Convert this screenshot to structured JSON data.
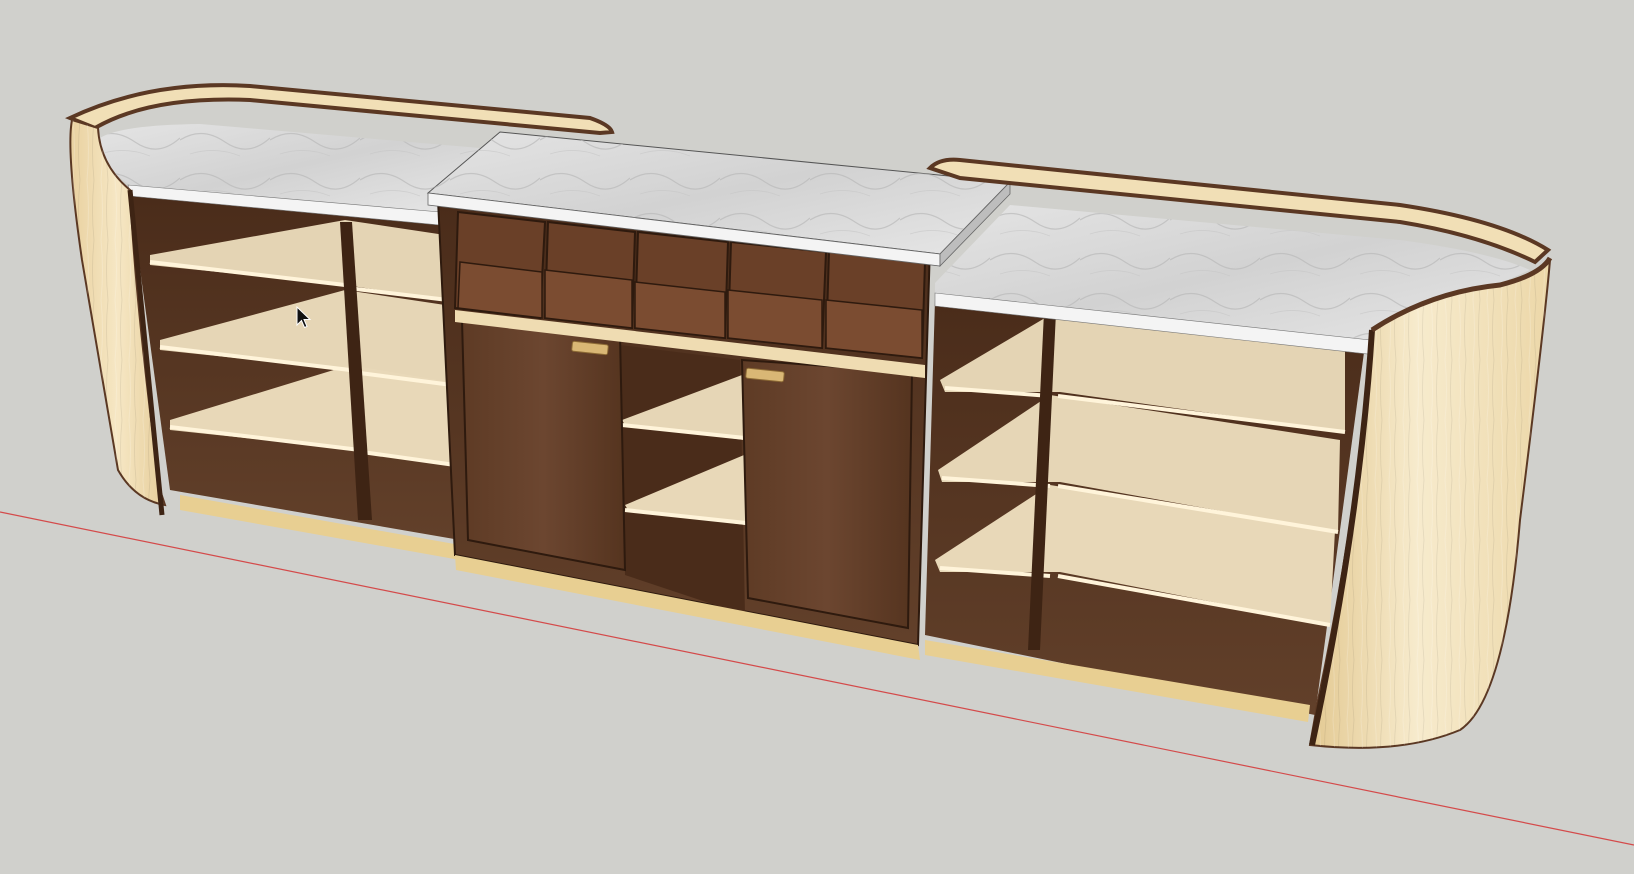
{
  "viewport": {
    "background_color": "#d0d0cc",
    "axis_color": "#d44a4a"
  },
  "model": {
    "materials": {
      "maple_veneer": "#efdcb2",
      "walnut": "#5b3823",
      "walnut_dark": "#3e2414",
      "shelf": "#e6d6b6",
      "marble": "#dcdcdc",
      "plinth": "#e8cf92",
      "brass": "#d9b775"
    },
    "bins_count": 5,
    "doors_count": 2
  },
  "cursor": {
    "icon": "arrow-cursor-icon"
  }
}
